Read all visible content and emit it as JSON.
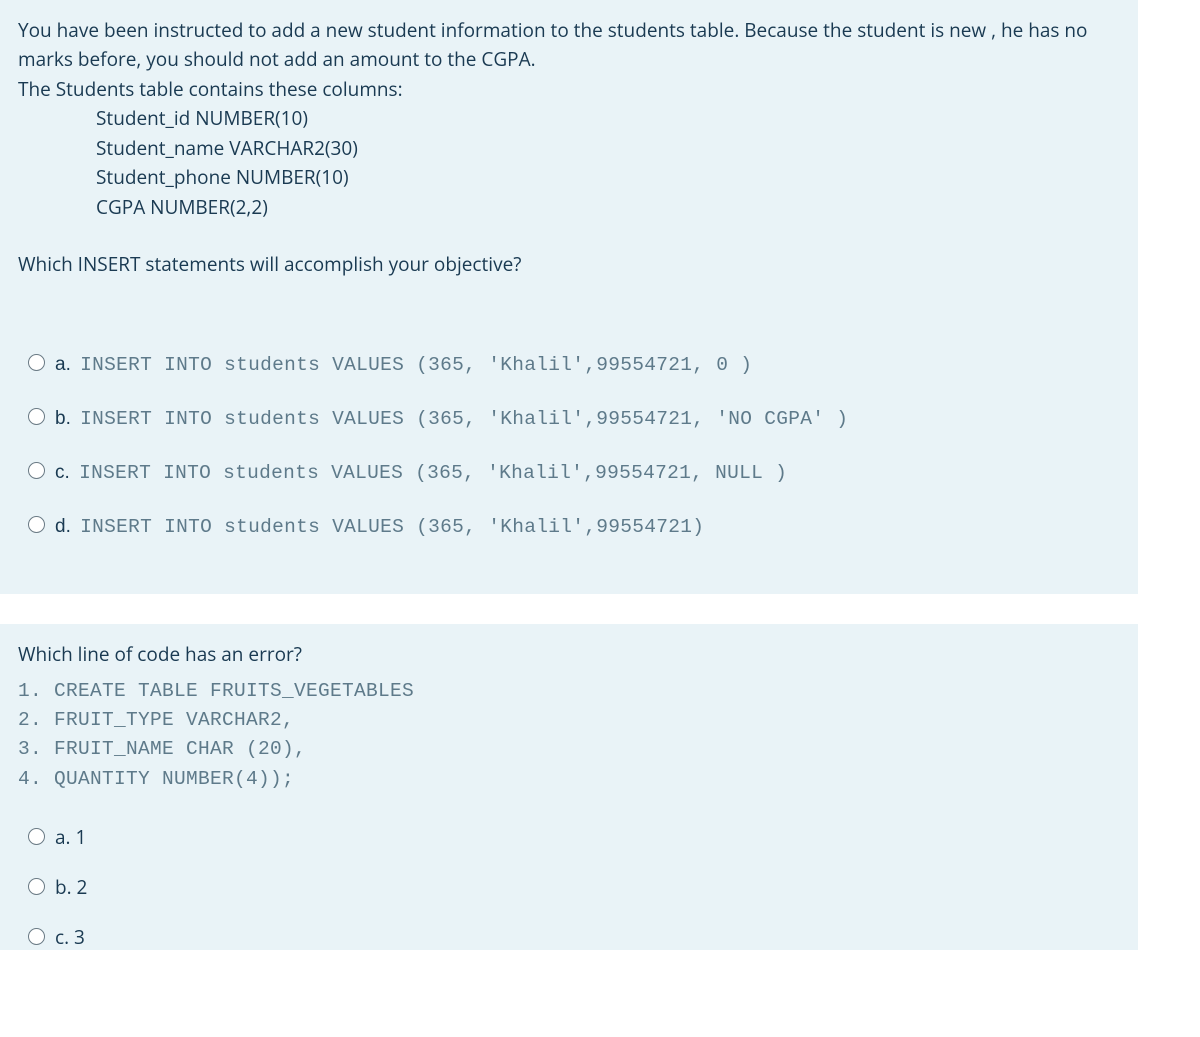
{
  "question1": {
    "stem_lines": [
      "You have been instructed to add a new student  information to the students table. Because the student is new , he has no marks before, you should not add an amount to the CGPA.",
      "The Students table contains these columns:"
    ],
    "columns": [
      "Student_id NUMBER(10)",
      "Student_name VARCHAR2(30)",
      "Student_phone NUMBER(10)",
      "CGPA NUMBER(2,2)"
    ],
    "prompt": "Which INSERT statements will accomplish your objective?",
    "options": [
      {
        "prefix": "a. ",
        "code": "INSERT INTO students VALUES (365, 'Khalil',99554721, 0 )"
      },
      {
        "prefix": "b. ",
        "code": "INSERT INTO students VALUES (365, 'Khalil',99554721, 'NO CGPA' )"
      },
      {
        "prefix": "c. ",
        "code": "INSERT INTO students VALUES (365, 'Khalil',99554721, NULL )"
      },
      {
        "prefix": "d. ",
        "code": "INSERT INTO students VALUES (365, 'Khalil',99554721)"
      }
    ]
  },
  "question2": {
    "stem": "Which line of code has an error?",
    "code_lines": [
      "1. CREATE TABLE FRUITS_VEGETABLES",
      "2. FRUIT_TYPE VARCHAR2,",
      "3. FRUIT_NAME CHAR (20),",
      "4. QUANTITY NUMBER(4));"
    ],
    "options": [
      {
        "label": "a. 1"
      },
      {
        "label": "b. 2"
      },
      {
        "label": "c. 3"
      }
    ]
  }
}
